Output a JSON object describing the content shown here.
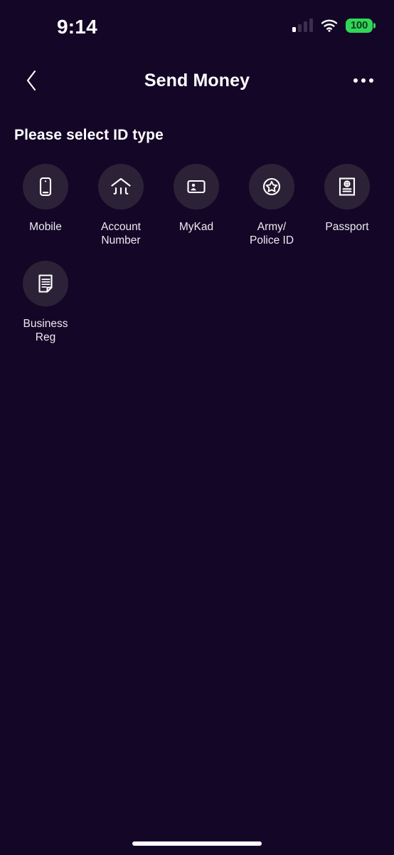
{
  "status_bar": {
    "time": "9:14",
    "battery_percent": "100",
    "signal_icon": "cellular-signal-icon",
    "wifi_icon": "wifi-icon",
    "battery_icon": "battery-icon"
  },
  "nav": {
    "title": "Send Money",
    "back_icon": "chevron-left-icon",
    "more_icon": "more-options-icon"
  },
  "main": {
    "section_title": "Please select ID type",
    "id_types": [
      {
        "label": "Mobile",
        "icon": "mobile-phone-icon"
      },
      {
        "label": "Account\nNumber",
        "icon": "bank-building-icon"
      },
      {
        "label": "MyKad",
        "icon": "id-card-icon"
      },
      {
        "label": "Army/\nPolice ID",
        "icon": "star-badge-icon"
      },
      {
        "label": "Passport",
        "icon": "passport-book-icon"
      },
      {
        "label": "Business\nReg",
        "icon": "document-icon"
      }
    ]
  },
  "system": {
    "home_indicator": "home-indicator"
  },
  "colors": {
    "background": "#140627",
    "circle": "#2c2237",
    "text_primary": "#ffffff",
    "text_label": "#eceaf0",
    "battery_green": "#32d657",
    "signal_dim": "#3b2f4d"
  }
}
